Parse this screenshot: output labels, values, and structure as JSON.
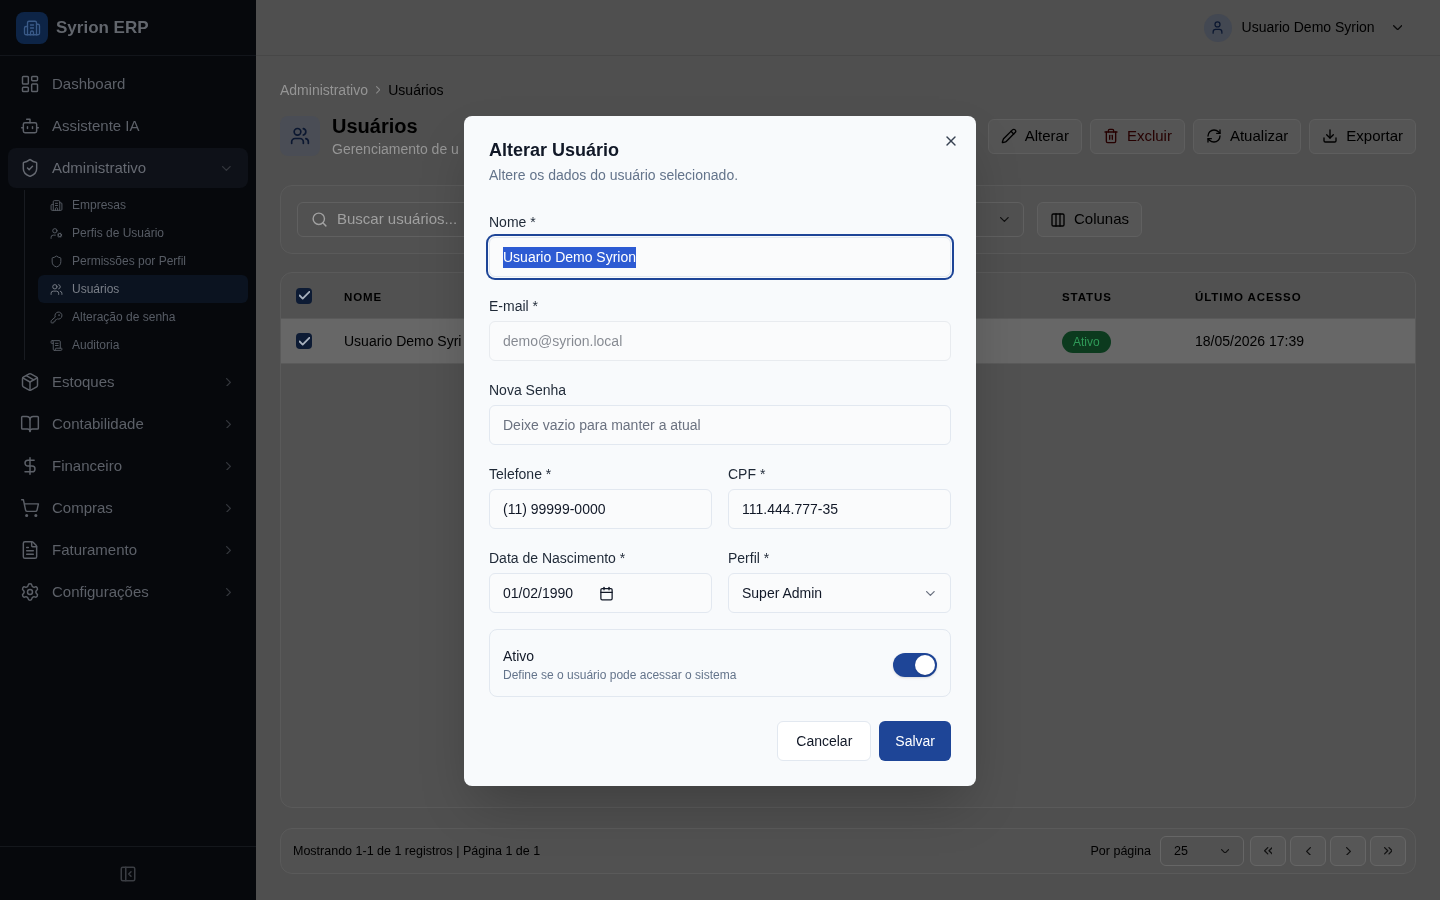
{
  "sidebar": {
    "brand": "Syrion ERP",
    "items": [
      {
        "label": "Dashboard",
        "kind": "link",
        "selected": false
      },
      {
        "label": "Assistente IA",
        "kind": "link",
        "selected": false
      },
      {
        "label": "Administrativo",
        "kind": "group",
        "selected": true,
        "expanded": true,
        "children": [
          {
            "label": "Empresas",
            "selected": false
          },
          {
            "label": "Perfis de Usuário",
            "selected": false
          },
          {
            "label": "Permissões por Perfil",
            "selected": false
          },
          {
            "label": "Usuários",
            "selected": true
          },
          {
            "label": "Alteração de senha",
            "selected": false
          },
          {
            "label": "Auditoria",
            "selected": false
          }
        ]
      },
      {
        "label": "Estoques",
        "kind": "group",
        "selected": false,
        "expanded": false
      },
      {
        "label": "Contabilidade",
        "kind": "group",
        "selected": false,
        "expanded": false
      },
      {
        "label": "Financeiro",
        "kind": "group",
        "selected": false,
        "expanded": false
      },
      {
        "label": "Compras",
        "kind": "group",
        "selected": false,
        "expanded": false
      },
      {
        "label": "Faturamento",
        "kind": "group",
        "selected": false,
        "expanded": false
      },
      {
        "label": "Configurações",
        "kind": "group",
        "selected": false,
        "expanded": false
      }
    ]
  },
  "header": {
    "user_menu": {
      "name": "Usuario Demo Syrion"
    }
  },
  "breadcrumb": [
    {
      "label": "Administrativo",
      "current": false
    },
    {
      "label": "Usuários",
      "current": true
    }
  ],
  "page_header": {
    "title": "Usuários",
    "subtitle": "Gerenciamento de u"
  },
  "toolbar": [
    {
      "label": "Alterar",
      "kind": "edit"
    },
    {
      "label": "Excluir",
      "kind": "delete"
    },
    {
      "label": "Atualizar",
      "kind": "refresh"
    },
    {
      "label": "Exportar",
      "kind": "export"
    }
  ],
  "filters": {
    "search": {
      "placeholder": "Buscar usuários..."
    },
    "columns_button": "Colunas"
  },
  "table": {
    "columns": [
      "NOME",
      "STATUS",
      "ÚLTIMO ACESSO"
    ],
    "all_checked": true,
    "rows": [
      {
        "checked": true,
        "selected": true,
        "name": "Usuario Demo Syri",
        "status": "Ativo",
        "last_access": "18/05/2026 17:39"
      }
    ]
  },
  "pagination": {
    "summary": "Mostrando 1-1 de 1 registros | Página 1 de 1",
    "per_page_label": "Por página",
    "per_page": "25"
  },
  "dialog": {
    "title": "Alterar Usuário",
    "description": "Altere os dados do usuário selecionado.",
    "field_rows": [
      {
        "fields": [
          {
            "label": "Nome *",
            "kind": "text",
            "value": "Usuario Demo Syrion",
            "focused": true,
            "text_selected": true,
            "disabled": false
          }
        ]
      },
      {
        "fields": [
          {
            "label": "E-mail *",
            "kind": "text",
            "value": "demo@syrion.local",
            "focused": false,
            "text_selected": false,
            "disabled": true
          }
        ]
      },
      {
        "fields": [
          {
            "label": "Nova Senha",
            "kind": "password",
            "placeholder": "Deixe vazio para manter a atual",
            "focused": false,
            "text_selected": false,
            "disabled": false
          }
        ]
      },
      {
        "fields": [
          {
            "label": "Telefone *",
            "kind": "text",
            "value": "(11) 99999-0000",
            "focused": false,
            "text_selected": false,
            "disabled": false
          },
          {
            "label": "CPF *",
            "kind": "text",
            "value": "111.444.777-35",
            "focused": false,
            "text_selected": false,
            "disabled": false
          }
        ]
      },
      {
        "fields": [
          {
            "label": "Data de Nascimento *",
            "kind": "date",
            "value": "01/02/1990",
            "focused": false,
            "text_selected": false,
            "disabled": false
          },
          {
            "label": "Perfil *",
            "kind": "select",
            "value": "Super Admin",
            "focused": false,
            "text_selected": false,
            "disabled": false
          }
        ]
      }
    ],
    "switch": {
      "label": "Ativo",
      "description": "Define se o usuário pode acessar o sistema",
      "on": true
    },
    "buttons": [
      {
        "label": "Cancelar",
        "kind": "secondary"
      },
      {
        "label": "Salvar",
        "kind": "primary"
      }
    ]
  }
}
